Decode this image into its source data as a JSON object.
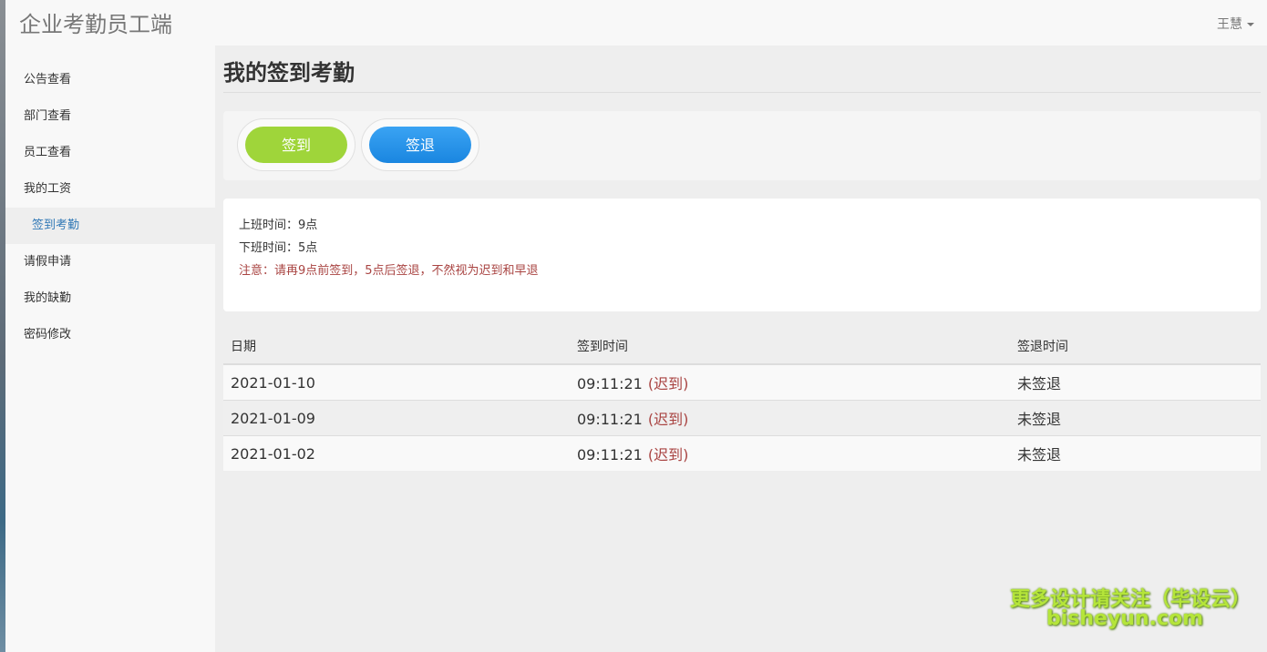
{
  "app_title": "企业考勤员工端",
  "user_menu": {
    "name": "王慧"
  },
  "sidebar": {
    "items": [
      {
        "label": "公告查看"
      },
      {
        "label": "部门查看"
      },
      {
        "label": "员工查看"
      },
      {
        "label": "我的工资"
      },
      {
        "label": "签到考勤",
        "active": true
      },
      {
        "label": "请假申请"
      },
      {
        "label": "我的缺勤"
      },
      {
        "label": "密码修改"
      }
    ]
  },
  "page": {
    "title": "我的签到考勤"
  },
  "actions": {
    "checkin_label": "签到",
    "checkout_label": "签退"
  },
  "info": {
    "work_start": "上班时间：9点",
    "work_end": "下班时间：5点",
    "notice": "注意：请再9点前签到，5点后签退，不然视为迟到和早退"
  },
  "table": {
    "headers": [
      "日期",
      "签到时间",
      "签退时间"
    ],
    "rows": [
      {
        "date": "2021-01-10",
        "checkin": "09:11:21",
        "status": "(迟到)",
        "checkout": "未签退"
      },
      {
        "date": "2021-01-09",
        "checkin": "09:11:21",
        "status": "(迟到)",
        "checkout": "未签退"
      },
      {
        "date": "2021-01-02",
        "checkin": "09:11:21",
        "status": "(迟到)",
        "checkout": "未签退"
      }
    ]
  },
  "watermark": {
    "line1": "更多设计请关注（毕设云）",
    "line2": "bisheyun.com"
  },
  "colors": {
    "checkin_button": "#9fd53a",
    "checkout_button": "#1a86e0",
    "late_text": "#a94442",
    "active_nav": "#337ab7"
  }
}
